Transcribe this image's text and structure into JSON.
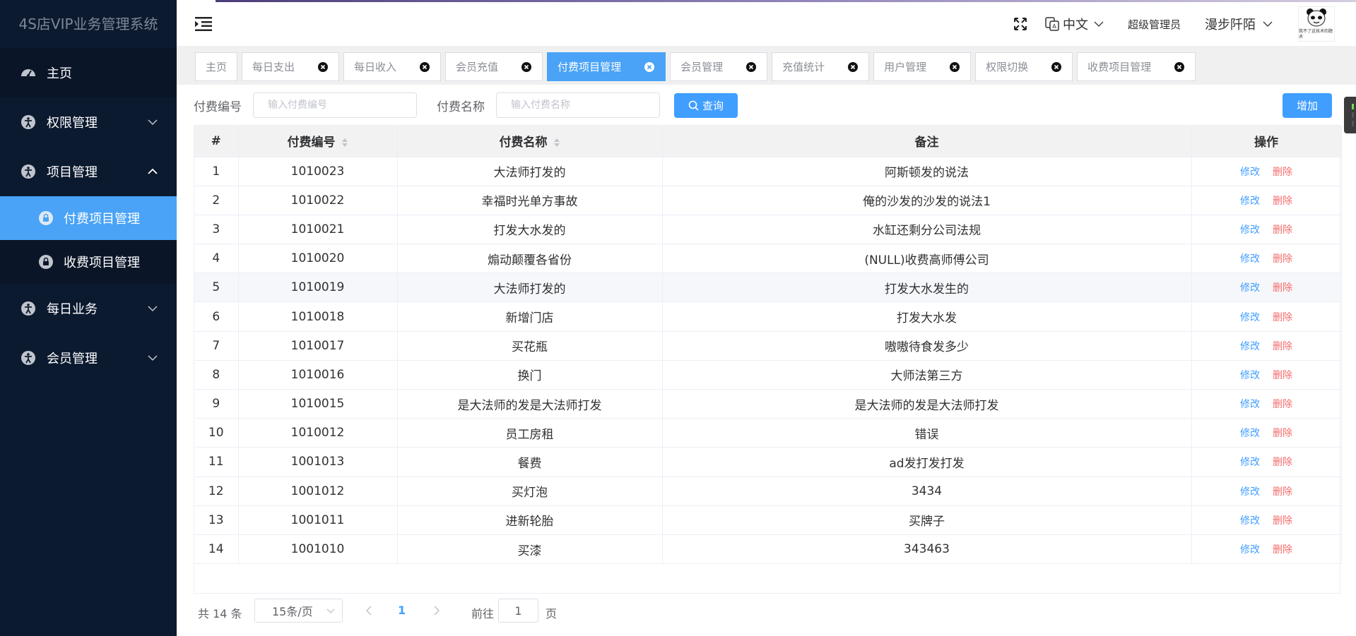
{
  "app": {
    "title": "4S店VIP业务管理系统"
  },
  "sidebar": {
    "home": "主页",
    "groups": [
      {
        "label": "权限管理",
        "expanded": false
      },
      {
        "label": "项目管理",
        "expanded": true,
        "children": [
          "付费项目管理",
          "收费项目管理"
        ]
      },
      {
        "label": "每日业务",
        "expanded": false
      },
      {
        "label": "会员管理",
        "expanded": false
      }
    ]
  },
  "header": {
    "language": "中文",
    "role": "超级管理员",
    "username": "漫步阡陌",
    "avatar_caption": "我不了这技术的题术"
  },
  "tabs": [
    {
      "label": "主页",
      "closable": false,
      "active": false
    },
    {
      "label": "每日支出",
      "closable": true,
      "active": false
    },
    {
      "label": "每日收入",
      "closable": true,
      "active": false
    },
    {
      "label": "会员充值",
      "closable": true,
      "active": false
    },
    {
      "label": "付费项目管理",
      "closable": true,
      "active": true
    },
    {
      "label": "会员管理",
      "closable": true,
      "active": false
    },
    {
      "label": "充值统计",
      "closable": true,
      "active": false
    },
    {
      "label": "用户管理",
      "closable": true,
      "active": false
    },
    {
      "label": "权限切换",
      "closable": true,
      "active": false
    },
    {
      "label": "收费项目管理",
      "closable": true,
      "active": false
    }
  ],
  "search": {
    "code_label": "付费编号",
    "code_placeholder": "输入付费编号",
    "name_label": "付费名称",
    "name_placeholder": "输入付费名称",
    "query_button": "查询",
    "add_button": "增加"
  },
  "table": {
    "headers": [
      "#",
      "付费编号",
      "付费名称",
      "备注",
      "操作"
    ],
    "edit_label": "修改",
    "delete_label": "删除",
    "rows": [
      [
        "1",
        "1010023",
        "大法师打发的",
        "阿斯顿发的说法"
      ],
      [
        "2",
        "1010022",
        "幸福时光单方事故",
        "俺的沙发的沙发的说法1"
      ],
      [
        "3",
        "1010021",
        "打发大水发的",
        "水缸还剩分公司法规"
      ],
      [
        "4",
        "1010020",
        "煽动颠覆各省份",
        "(NULL)收费高师傅公司"
      ],
      [
        "5",
        "1010019",
        "大法师打发的",
        "打发大水发生的"
      ],
      [
        "6",
        "1010018",
        "新增门店",
        "打发大水发"
      ],
      [
        "7",
        "1010017",
        "买花瓶",
        "嗷嗷待食发多少"
      ],
      [
        "8",
        "1010016",
        "换门",
        "大师法第三方"
      ],
      [
        "9",
        "1010015",
        "是大法师的发是大法师打发",
        "是大法师的发是大法师打发"
      ],
      [
        "10",
        "1010012",
        "员工房租",
        "错误"
      ],
      [
        "11",
        "1001013",
        "餐费",
        "ad发打发打发"
      ],
      [
        "12",
        "1001012",
        "买灯泡",
        "3434"
      ],
      [
        "13",
        "1001011",
        "进新轮胎",
        "买牌子"
      ],
      [
        "14",
        "1001010",
        "买漆",
        "343463"
      ]
    ],
    "hover_row": 5
  },
  "pagination": {
    "total": "共 14 条",
    "page_size": "15条/页",
    "current_page": "1",
    "goto_label": "前往",
    "goto_value": "1",
    "page_suffix": "页"
  },
  "colors": {
    "sidebar_bg": "#0c1a30",
    "active_blue": "#4aa3f6",
    "primary": "#409eff",
    "danger": "#f56c6c"
  }
}
